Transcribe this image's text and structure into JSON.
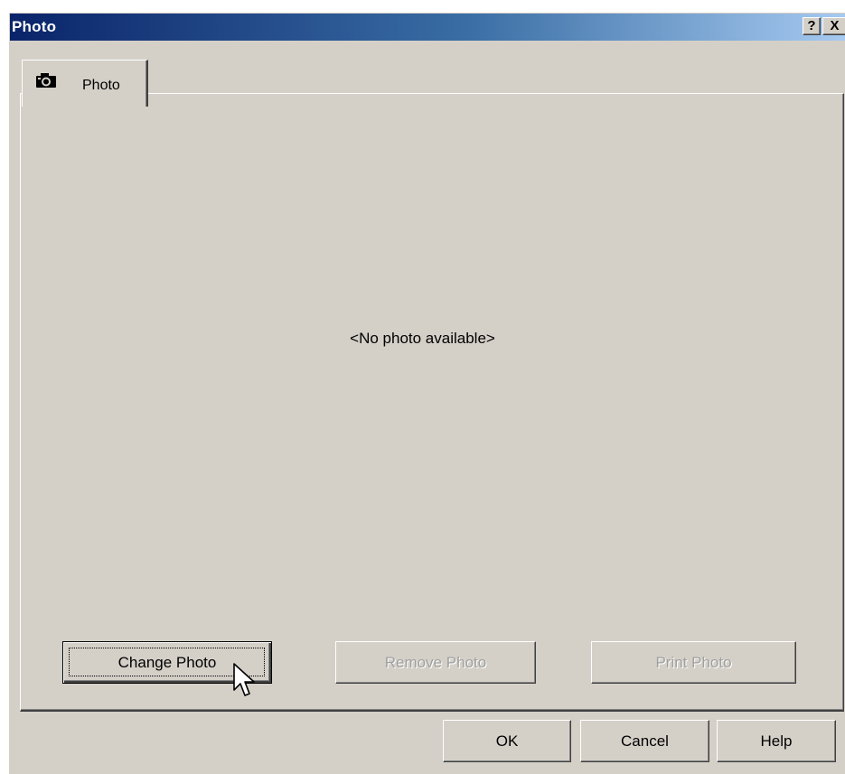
{
  "window": {
    "title": "Photo",
    "help_glyph": "?",
    "close_glyph": "X"
  },
  "tabs": [
    {
      "label": "Photo",
      "icon": "camera-icon",
      "selected": true
    }
  ],
  "panel": {
    "placeholder_text": "<No photo available>"
  },
  "photo_buttons": {
    "change": {
      "label": "Change Photo",
      "enabled": true,
      "default": true
    },
    "remove": {
      "label": "Remove Photo",
      "enabled": false
    },
    "print": {
      "label": "Print Photo",
      "enabled": false
    }
  },
  "dialog_buttons": {
    "ok": "OK",
    "cancel": "Cancel",
    "help": "Help"
  },
  "colors": {
    "face": "#d4d0c8",
    "title_start": "#0a246a",
    "title_end": "#a6caf0",
    "disabled_text": "#a0a0a0"
  },
  "cursor": {
    "icon": "arrow-cursor-icon"
  }
}
